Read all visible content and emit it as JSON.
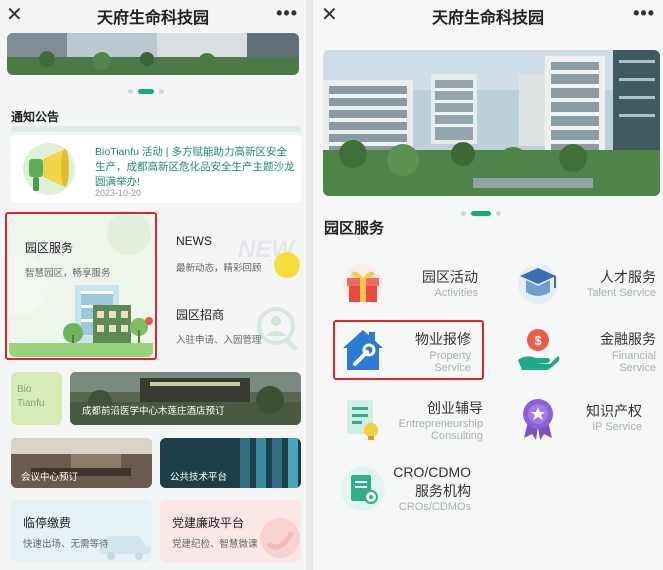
{
  "left": {
    "app_title": "天府生命科技园",
    "notice": {
      "section_title": "通知公告",
      "headline": "BioTianfu 活动 | 多方赋能助力高新区安全生产，成都高新区危化品安全生产主题沙龙圆满举办!",
      "date": "2023-10-20"
    },
    "tiles": {
      "park_service": {
        "title": "园区服务",
        "subtitle": "智慧园区，畅享服务"
      },
      "news": {
        "title": "NEWS",
        "subtitle": "最新动态，精彩回顾",
        "watermark": "NEW"
      },
      "recruit": {
        "title": "园区招商",
        "subtitle": "入驻申请、入园管理"
      },
      "bio_logo": [
        "Bio",
        "Tianfu"
      ],
      "hotel": {
        "title": "成都前沿医学中心木莲庄酒店预订"
      },
      "meeting": {
        "title": "会议中心预订"
      },
      "tech_platform": {
        "title": "公共技术平台"
      },
      "parking": {
        "title": "临停缴费",
        "subtitle": "快速出场、无需等待"
      },
      "party": {
        "title": "党建廉政平台",
        "subtitle": "党建纪检、智慧微课"
      }
    }
  },
  "right": {
    "app_title": "天府生命科技园",
    "section_title": "园区服务",
    "services": [
      {
        "cn": "园区活动",
        "en": [
          "Activities"
        ],
        "icon": "gift-icon"
      },
      {
        "cn": "人才服务",
        "en": [
          "Talent Service"
        ],
        "icon": "graduation-cap-icon"
      },
      {
        "cn": "物业报修",
        "en": [
          "Property",
          "Service"
        ],
        "icon": "house-wrench-icon"
      },
      {
        "cn": "金融服务",
        "en": [
          "Financial",
          "Service"
        ],
        "icon": "money-hand-icon"
      },
      {
        "cn": "创业辅导",
        "en": [
          "Entrepreneurship",
          "Consulting"
        ],
        "icon": "document-bulb-icon"
      },
      {
        "cn": "知识产权",
        "en": [
          "IP Service"
        ],
        "icon": "medal-icon"
      },
      {
        "cn": [
          "CRO/CDMO",
          "服务机构"
        ],
        "en": [
          "CROs/CDMOs"
        ],
        "icon": "document-gear-icon"
      }
    ]
  },
  "colors": {
    "accent": "#1aa97f",
    "highlight_box": "#e0252b",
    "park_bg": "#eef5ea"
  },
  "icons": {
    "close": "close-icon",
    "more": "more-icon"
  }
}
